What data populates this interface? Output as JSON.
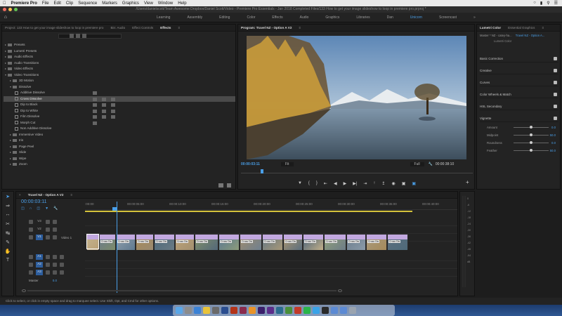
{
  "menubar": {
    "app": "Premiere Pro",
    "items": [
      "File",
      "Edit",
      "Clip",
      "Sequence",
      "Markers",
      "Graphics",
      "View",
      "Window",
      "Help"
    ]
  },
  "titlebar": {
    "path": "/Users/danielscott/Team Awesome Dropbox/Daniel Scott/Video - Premiere Pro Essentials - Jan 2018 Completed Files/133 How to get your image slideshow to loop in premiere pro.prproj *"
  },
  "workspaces": {
    "items": [
      "Learning",
      "Assembly",
      "Editing",
      "Color",
      "Effects",
      "Audio",
      "Graphics",
      "Libraries",
      "Dan",
      "Unicorn",
      "Screencast"
    ],
    "active": "Unicorn"
  },
  "effects_panel": {
    "project_tab": "Project: 133 How to get your image slideshow to loop in premiere pro",
    "tabs": [
      "Bin: Audio",
      "Effect Controls",
      "Effects"
    ],
    "active_tab": "Effects",
    "tree": [
      {
        "label": "Presets",
        "depth": 0,
        "type": "folder"
      },
      {
        "label": "Lumetri Presets",
        "depth": 0,
        "type": "folder"
      },
      {
        "label": "Audio Effects",
        "depth": 0,
        "type": "folder"
      },
      {
        "label": "Audio Transitions",
        "depth": 0,
        "type": "folder"
      },
      {
        "label": "Video Effects",
        "depth": 0,
        "type": "folder"
      },
      {
        "label": "Video Transitions",
        "depth": 0,
        "type": "folder",
        "open": true
      },
      {
        "label": "3D Motion",
        "depth": 1,
        "type": "folder"
      },
      {
        "label": "Dissolve",
        "depth": 1,
        "type": "folder",
        "open": true
      },
      {
        "label": "Additive Dissolve",
        "depth": 2,
        "type": "effect",
        "badges": 1
      },
      {
        "label": "Cross Dissolve",
        "depth": 2,
        "type": "effect",
        "badges": 3,
        "selected": true
      },
      {
        "label": "Dip to Black",
        "depth": 2,
        "type": "effect",
        "badges": 3
      },
      {
        "label": "Dip to White",
        "depth": 2,
        "type": "effect",
        "badges": 3
      },
      {
        "label": "Film Dissolve",
        "depth": 2,
        "type": "effect",
        "badges": 3
      },
      {
        "label": "Morph Cut",
        "depth": 2,
        "type": "effect",
        "badges": 1
      },
      {
        "label": "Non Additive Dissolve",
        "depth": 2,
        "type": "effect",
        "badges": 0
      },
      {
        "label": "Immersive Video",
        "depth": 1,
        "type": "folder"
      },
      {
        "label": "Iris",
        "depth": 1,
        "type": "folder"
      },
      {
        "label": "Page Peel",
        "depth": 1,
        "type": "folder"
      },
      {
        "label": "Slide",
        "depth": 1,
        "type": "folder"
      },
      {
        "label": "Wipe",
        "depth": 1,
        "type": "folder"
      },
      {
        "label": "Zoom",
        "depth": 1,
        "type": "folder"
      }
    ]
  },
  "program_monitor": {
    "title": "Program: Travel NZ - Option A V2",
    "timecode": "00:00:03:11",
    "fit": "Fit",
    "quality": "Full",
    "duration": "00:00:38:10",
    "transport": [
      "marker",
      "in",
      "out",
      "step-back",
      "play",
      "step-forward",
      "out-point",
      "lift",
      "extract",
      "export-frame",
      "button-editor",
      "vr"
    ],
    "add_button": "+"
  },
  "lumetri": {
    "tabs": [
      "Lumetri Color",
      "Essential Graphics"
    ],
    "active_tab": "Lumetri Color",
    "master_label": "Master * NZ - catey-ha...",
    "clip_label": "Travel NZ - Option A...",
    "sub_label": "Lumetri Color",
    "sections": [
      "Basic Correction",
      "Creative",
      "Curves",
      "Color Wheels & Match",
      "HSL Secondary",
      "Vignette"
    ],
    "sliders": [
      {
        "label": "Amount",
        "value": "0.0",
        "pos": 0.5
      },
      {
        "label": "Midpoint",
        "value": "50.0",
        "pos": 0.5
      },
      {
        "label": "Roundness",
        "value": "0.0",
        "pos": 0.5
      },
      {
        "label": "Feather",
        "value": "50.0",
        "pos": 0.5
      }
    ]
  },
  "timeline": {
    "title": "Travel NZ - Option A V2",
    "timecode": "00:00:03:11",
    "ruler": [
      ":00:00",
      "00:00:05:00",
      "00:00:10:00",
      "00:00:15:00",
      "00:00:20:00",
      "00:00:25:00",
      "00:00:30:00",
      "00:00:35:00",
      "00:00:40:00"
    ],
    "tracks": [
      {
        "id": "V3",
        "kind": "video"
      },
      {
        "id": "V2",
        "kind": "video"
      },
      {
        "id": "V1",
        "kind": "video",
        "label": "Video 1"
      },
      {
        "id": "A1",
        "kind": "audio"
      },
      {
        "id": "A2",
        "kind": "audio"
      },
      {
        "id": "A3",
        "kind": "audio"
      }
    ],
    "master": {
      "label": "Master",
      "value": "0.0"
    },
    "clip_label": "Cross Dis",
    "playhead_fraction": 0.084
  },
  "meters": {
    "scale": [
      "0",
      "-6",
      "-12",
      "-18",
      "-24",
      "-30",
      "-36",
      "-42",
      "-48",
      "-54",
      "dB"
    ]
  },
  "status": {
    "text": "Click to select, or click in empty space and drag to marquee select. Use Shift, Opt, and Cmd for other options."
  },
  "colors": {
    "accent": "#4a9fe8",
    "clip_header": "#c2a8e0",
    "audio_clip": "#2f8a6b"
  }
}
